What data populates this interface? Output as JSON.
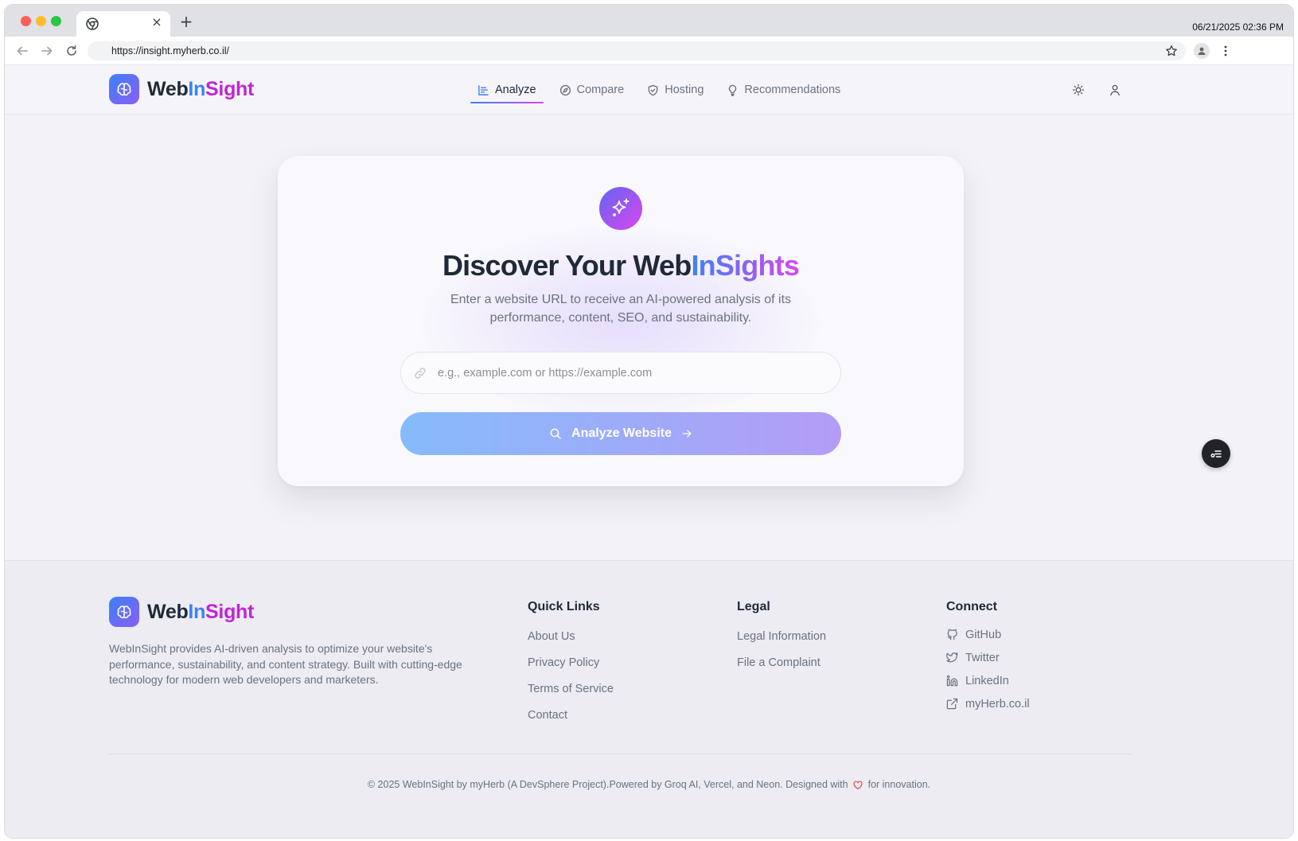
{
  "browser": {
    "tab_close": "×",
    "new_tab": "+",
    "clock": "06/21/2025 02:36 PM",
    "url": "https://insight.myherb.co.il/"
  },
  "brand": {
    "web": "Web",
    "in": "In",
    "sight": "Sight",
    "colors": {
      "blue": "#3b82f6",
      "purple": "#8b5cf6",
      "magenta": "#d946ef"
    }
  },
  "nav": {
    "items": [
      {
        "label": "Analyze",
        "icon": "chart-icon",
        "active": true
      },
      {
        "label": "Compare",
        "icon": "compass-icon",
        "active": false
      },
      {
        "label": "Hosting",
        "icon": "shield-icon",
        "active": false
      },
      {
        "label": "Recommendations",
        "icon": "lightbulb-icon",
        "active": false
      }
    ]
  },
  "hero": {
    "title_plain": "Discover Your Web",
    "title_gradient": "InSights",
    "subtitle": "Enter a website URL to receive an AI-powered analysis of its performance, content, SEO, and sustainability.",
    "input_placeholder": "e.g., example.com or https://example.com",
    "input_value": "",
    "button_label": "Analyze Website"
  },
  "footer": {
    "description": "WebInSight provides AI-driven analysis to optimize your website's performance, sustainability, and content strategy. Built with cutting-edge technology for modern web developers and marketers.",
    "quick_links": {
      "title": "Quick Links",
      "items": [
        "About Us",
        "Privacy Policy",
        "Terms of Service",
        "Contact"
      ]
    },
    "legal": {
      "title": "Legal",
      "items": [
        "Legal Information",
        "File a Complaint"
      ]
    },
    "connect": {
      "title": "Connect",
      "items": [
        {
          "label": "GitHub",
          "icon": "github-icon"
        },
        {
          "label": "Twitter",
          "icon": "twitter-icon"
        },
        {
          "label": "LinkedIn",
          "icon": "linkedin-icon"
        },
        {
          "label": "myHerb.co.il",
          "icon": "external-link-icon"
        }
      ]
    },
    "copyright_before": "© 2025 WebInSight by myHerb (A DevSphere Project).Powered by Groq AI, Vercel, and Neon. Designed with",
    "copyright_after": "for innovation."
  }
}
